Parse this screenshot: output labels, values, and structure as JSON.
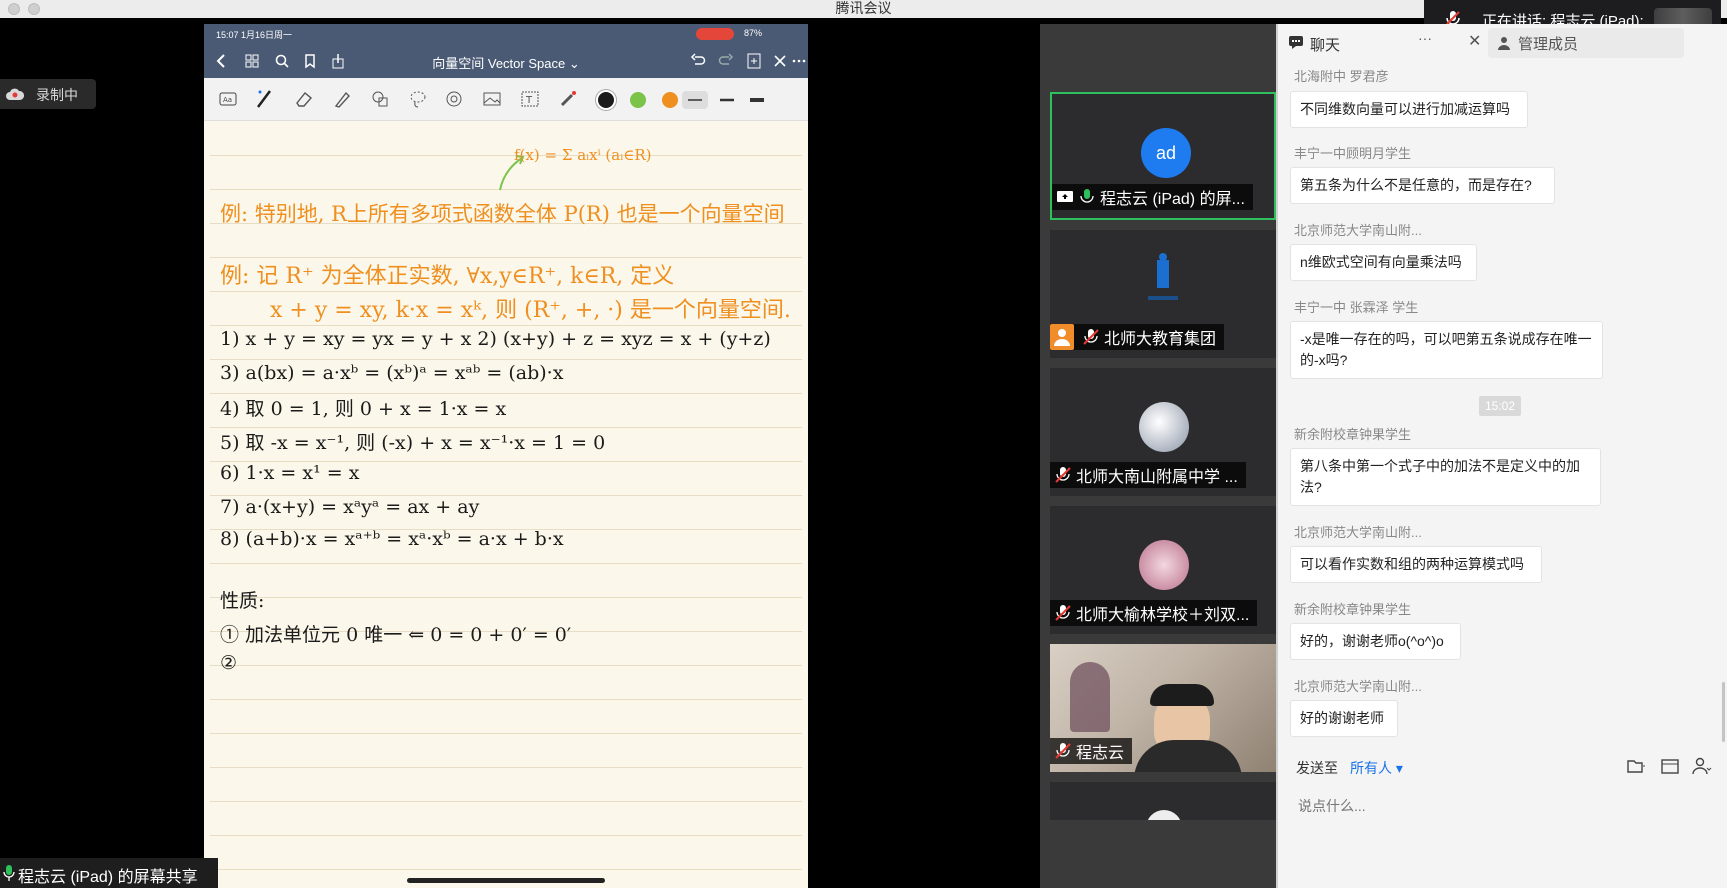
{
  "window": {
    "title": "腾讯会议"
  },
  "speaking": {
    "label": "正在讲话: 程志云 (iPad);"
  },
  "recording": {
    "label": "录制中"
  },
  "screen_share": {
    "label": "程志云 (iPad) 的屏幕共享"
  },
  "ipad": {
    "status_time": "15:07  1月16日周一",
    "battery": "87%",
    "doc_title": "向量空间 Vector Space ⌄",
    "colors": {
      "black": "#1b1b1b",
      "green": "#7cc34a",
      "orange": "#ef8f1f"
    },
    "notes": {
      "formula_top": "f(x) = Σ aᵢxⁱ  (aᵢ∈R)",
      "ex1": "例: 特别地, R上所有多项式函数全体 P(R) 也是一个向量空间",
      "ex2a": "例: 记 R⁺ 为全体正实数, ∀x,y∈R⁺, k∈R, 定义",
      "ex2b": "x + y = xy,  k·x = xᵏ,  则 (R⁺, +, ·) 是一个向量空间.",
      "l1": "1) x + y = xy = yx = y + x     2) (x+y) + z = xyz = x + (y+z)",
      "l3": "3) a(bx) = a·xᵇ = (xᵇ)ᵃ = xᵃᵇ = (ab)·x",
      "l4": "4) 取 0 = 1,  则 0 + x = 1·x = x",
      "l5": "5) 取 -x = x⁻¹,  则 (-x) + x = x⁻¹·x = 1 = 0",
      "l6": "6) 1·x = x¹ = x",
      "l7": "7) a·(x+y) = xᵃyᵃ = ax + ay",
      "l8": "8) (a+b)·x = xᵃ⁺ᵇ = xᵃ·xᵇ = a·x + b·x",
      "prop": "性质:",
      "p1": "① 加法单位元 0 唯一 ⇐ 0 = 0 + 0′ = 0′",
      "p2": "②"
    }
  },
  "participants": [
    {
      "name": "程志云 (iPad) 的屏...",
      "avatar_text": "ad",
      "avatar_color": "#1e7cf0",
      "icon": "screen-share-icon"
    },
    {
      "name": "北师大教育集团",
      "icon": "person-icon"
    },
    {
      "name": "北师大南山附属中学 ...",
      "icon": "mic-muted-icon"
    },
    {
      "name": "北师大榆林学校＋刘双...",
      "icon": "mic-muted-icon"
    },
    {
      "name": "程志云",
      "icon": "mic-muted-icon"
    }
  ],
  "chat": {
    "tab_label": "聊天",
    "more": "···",
    "close": "✕",
    "members_tab": "管理成员",
    "messages": [
      {
        "sender": "北海附中 罗君彦",
        "text": "不同维数向量可以进行加减运算吗"
      },
      {
        "sender": "丰宁一中顾明月学生",
        "text": "第五条为什么不是任意的，而是存在?"
      },
      {
        "sender": "北京师范大学南山附...",
        "text": "n维欧式空间有向量乘法吗"
      },
      {
        "sender": "丰宁一中 张霖泽 学生",
        "text": "-x是唯一存在的吗，可以吧第五条说成存在唯一的-x吗?"
      },
      {
        "sender": "新余附校章钟果学生",
        "text": "第八条中第一个式子中的加法不是定义中的加法?"
      },
      {
        "sender": "北京师范大学南山附...",
        "text": "可以看作实数和组的两种运算模式吗"
      },
      {
        "sender": "新余附校章钟果学生",
        "text": "好的，谢谢老师o(^o^)o"
      },
      {
        "sender": "北京师范大学南山附...",
        "text": "好的谢谢老师"
      }
    ],
    "time_chip": "15:02",
    "send_to_label": "发送至",
    "send_to_target": "所有人 ▾",
    "compose_placeholder": "说点什么..."
  }
}
